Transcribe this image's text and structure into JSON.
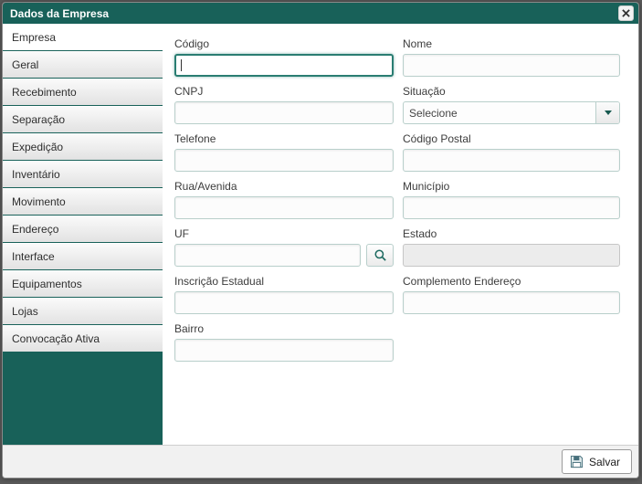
{
  "window": {
    "title": "Dados da Empresa"
  },
  "sidebar": {
    "tabs": [
      {
        "label": "Empresa",
        "active": true
      },
      {
        "label": "Geral",
        "active": false
      },
      {
        "label": "Recebimento",
        "active": false
      },
      {
        "label": "Separação",
        "active": false
      },
      {
        "label": "Expedição",
        "active": false
      },
      {
        "label": "Inventário",
        "active": false
      },
      {
        "label": "Movimento",
        "active": false
      },
      {
        "label": "Endereço",
        "active": false
      },
      {
        "label": "Interface",
        "active": false
      },
      {
        "label": "Equipamentos",
        "active": false
      },
      {
        "label": "Lojas",
        "active": false
      },
      {
        "label": "Convocação Ativa",
        "active": false
      }
    ]
  },
  "form": {
    "codigo": {
      "label": "Código",
      "value": ""
    },
    "nome": {
      "label": "Nome",
      "value": ""
    },
    "cnpj": {
      "label": "CNPJ",
      "value": ""
    },
    "situacao": {
      "label": "Situação",
      "value": "Selecione"
    },
    "telefone": {
      "label": "Telefone",
      "value": ""
    },
    "codigo_postal": {
      "label": "Código Postal",
      "value": ""
    },
    "rua_avenida": {
      "label": "Rua/Avenida",
      "value": ""
    },
    "municipio": {
      "label": "Município",
      "value": ""
    },
    "uf": {
      "label": "UF",
      "value": ""
    },
    "estado": {
      "label": "Estado",
      "value": ""
    },
    "inscricao_estadual": {
      "label": "Inscrição Estadual",
      "value": ""
    },
    "complemento_endereco": {
      "label": "Complemento Endereço",
      "value": ""
    },
    "bairro": {
      "label": "Bairro",
      "value": ""
    }
  },
  "footer": {
    "save_label": "Salvar"
  },
  "colors": {
    "teal": "#186159",
    "focus_border": "#2a7d72"
  }
}
